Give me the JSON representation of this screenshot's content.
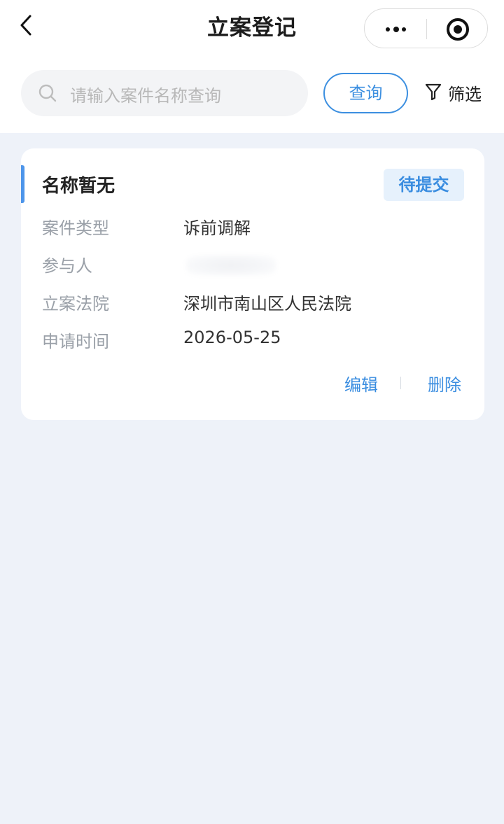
{
  "nav": {
    "title": "立案登记",
    "back_icon": "chevron-left-icon",
    "more_icon": "more-dots-icon",
    "record_icon": "record-circle-icon"
  },
  "search": {
    "placeholder": "请输入案件名称查询",
    "value": "",
    "query_label": "查询",
    "filter_label": "筛选",
    "filter_icon": "funnel-icon"
  },
  "cases": [
    {
      "title": "名称暂无",
      "status": "待提交",
      "fields": [
        {
          "label": "案件类型",
          "value": "诉前调解"
        },
        {
          "label": "参与人",
          "value": ""
        },
        {
          "label": "立案法院",
          "value": "深圳市南山区人民法院"
        },
        {
          "label": "申请时间",
          "value": "2026-05-25"
        }
      ],
      "actions": {
        "edit": "编辑",
        "delete": "删除"
      }
    }
  ],
  "colors": {
    "accent": "#3c8fe0",
    "background": "#eef2f9",
    "status_badge_bg": "#e6f1fc"
  }
}
